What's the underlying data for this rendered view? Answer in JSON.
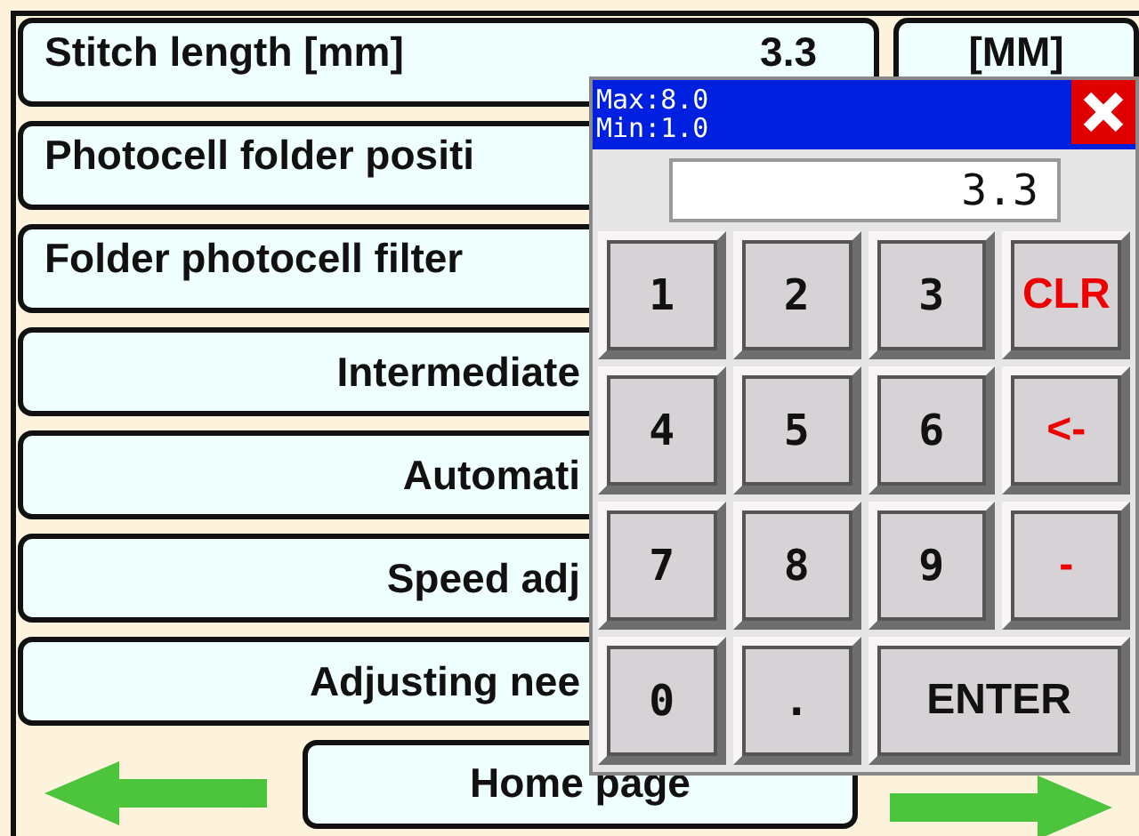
{
  "rows": [
    {
      "kind": "setting",
      "label": "Stitch length [mm]",
      "value": "3.3",
      "unit": "[MM]"
    },
    {
      "kind": "setting",
      "label": "Photocell folder positi"
    },
    {
      "kind": "setting",
      "label": "Folder photocell filter"
    },
    {
      "kind": "menu",
      "label": "Intermediate"
    },
    {
      "kind": "menu",
      "label": "Automati"
    },
    {
      "kind": "menu",
      "label": "Speed adj"
    },
    {
      "kind": "menu",
      "label": "Adjusting nee"
    }
  ],
  "nav": {
    "home": "Home page"
  },
  "keypad": {
    "max": "Max:8.0",
    "min": "Min:1.0",
    "display": "3.3",
    "keys": [
      {
        "label": "1",
        "kind": "digit"
      },
      {
        "label": "2",
        "kind": "digit"
      },
      {
        "label": "3",
        "kind": "digit"
      },
      {
        "label": "CLR",
        "kind": "action"
      },
      {
        "label": "4",
        "kind": "digit"
      },
      {
        "label": "5",
        "kind": "digit"
      },
      {
        "label": "6",
        "kind": "digit"
      },
      {
        "label": "<-",
        "kind": "action"
      },
      {
        "label": "7",
        "kind": "digit"
      },
      {
        "label": "8",
        "kind": "digit"
      },
      {
        "label": "9",
        "kind": "digit"
      },
      {
        "label": "-",
        "kind": "action"
      },
      {
        "label": "0",
        "kind": "digit"
      },
      {
        "label": ".",
        "kind": "digit"
      },
      {
        "label": "ENTER",
        "kind": "enter"
      }
    ]
  }
}
